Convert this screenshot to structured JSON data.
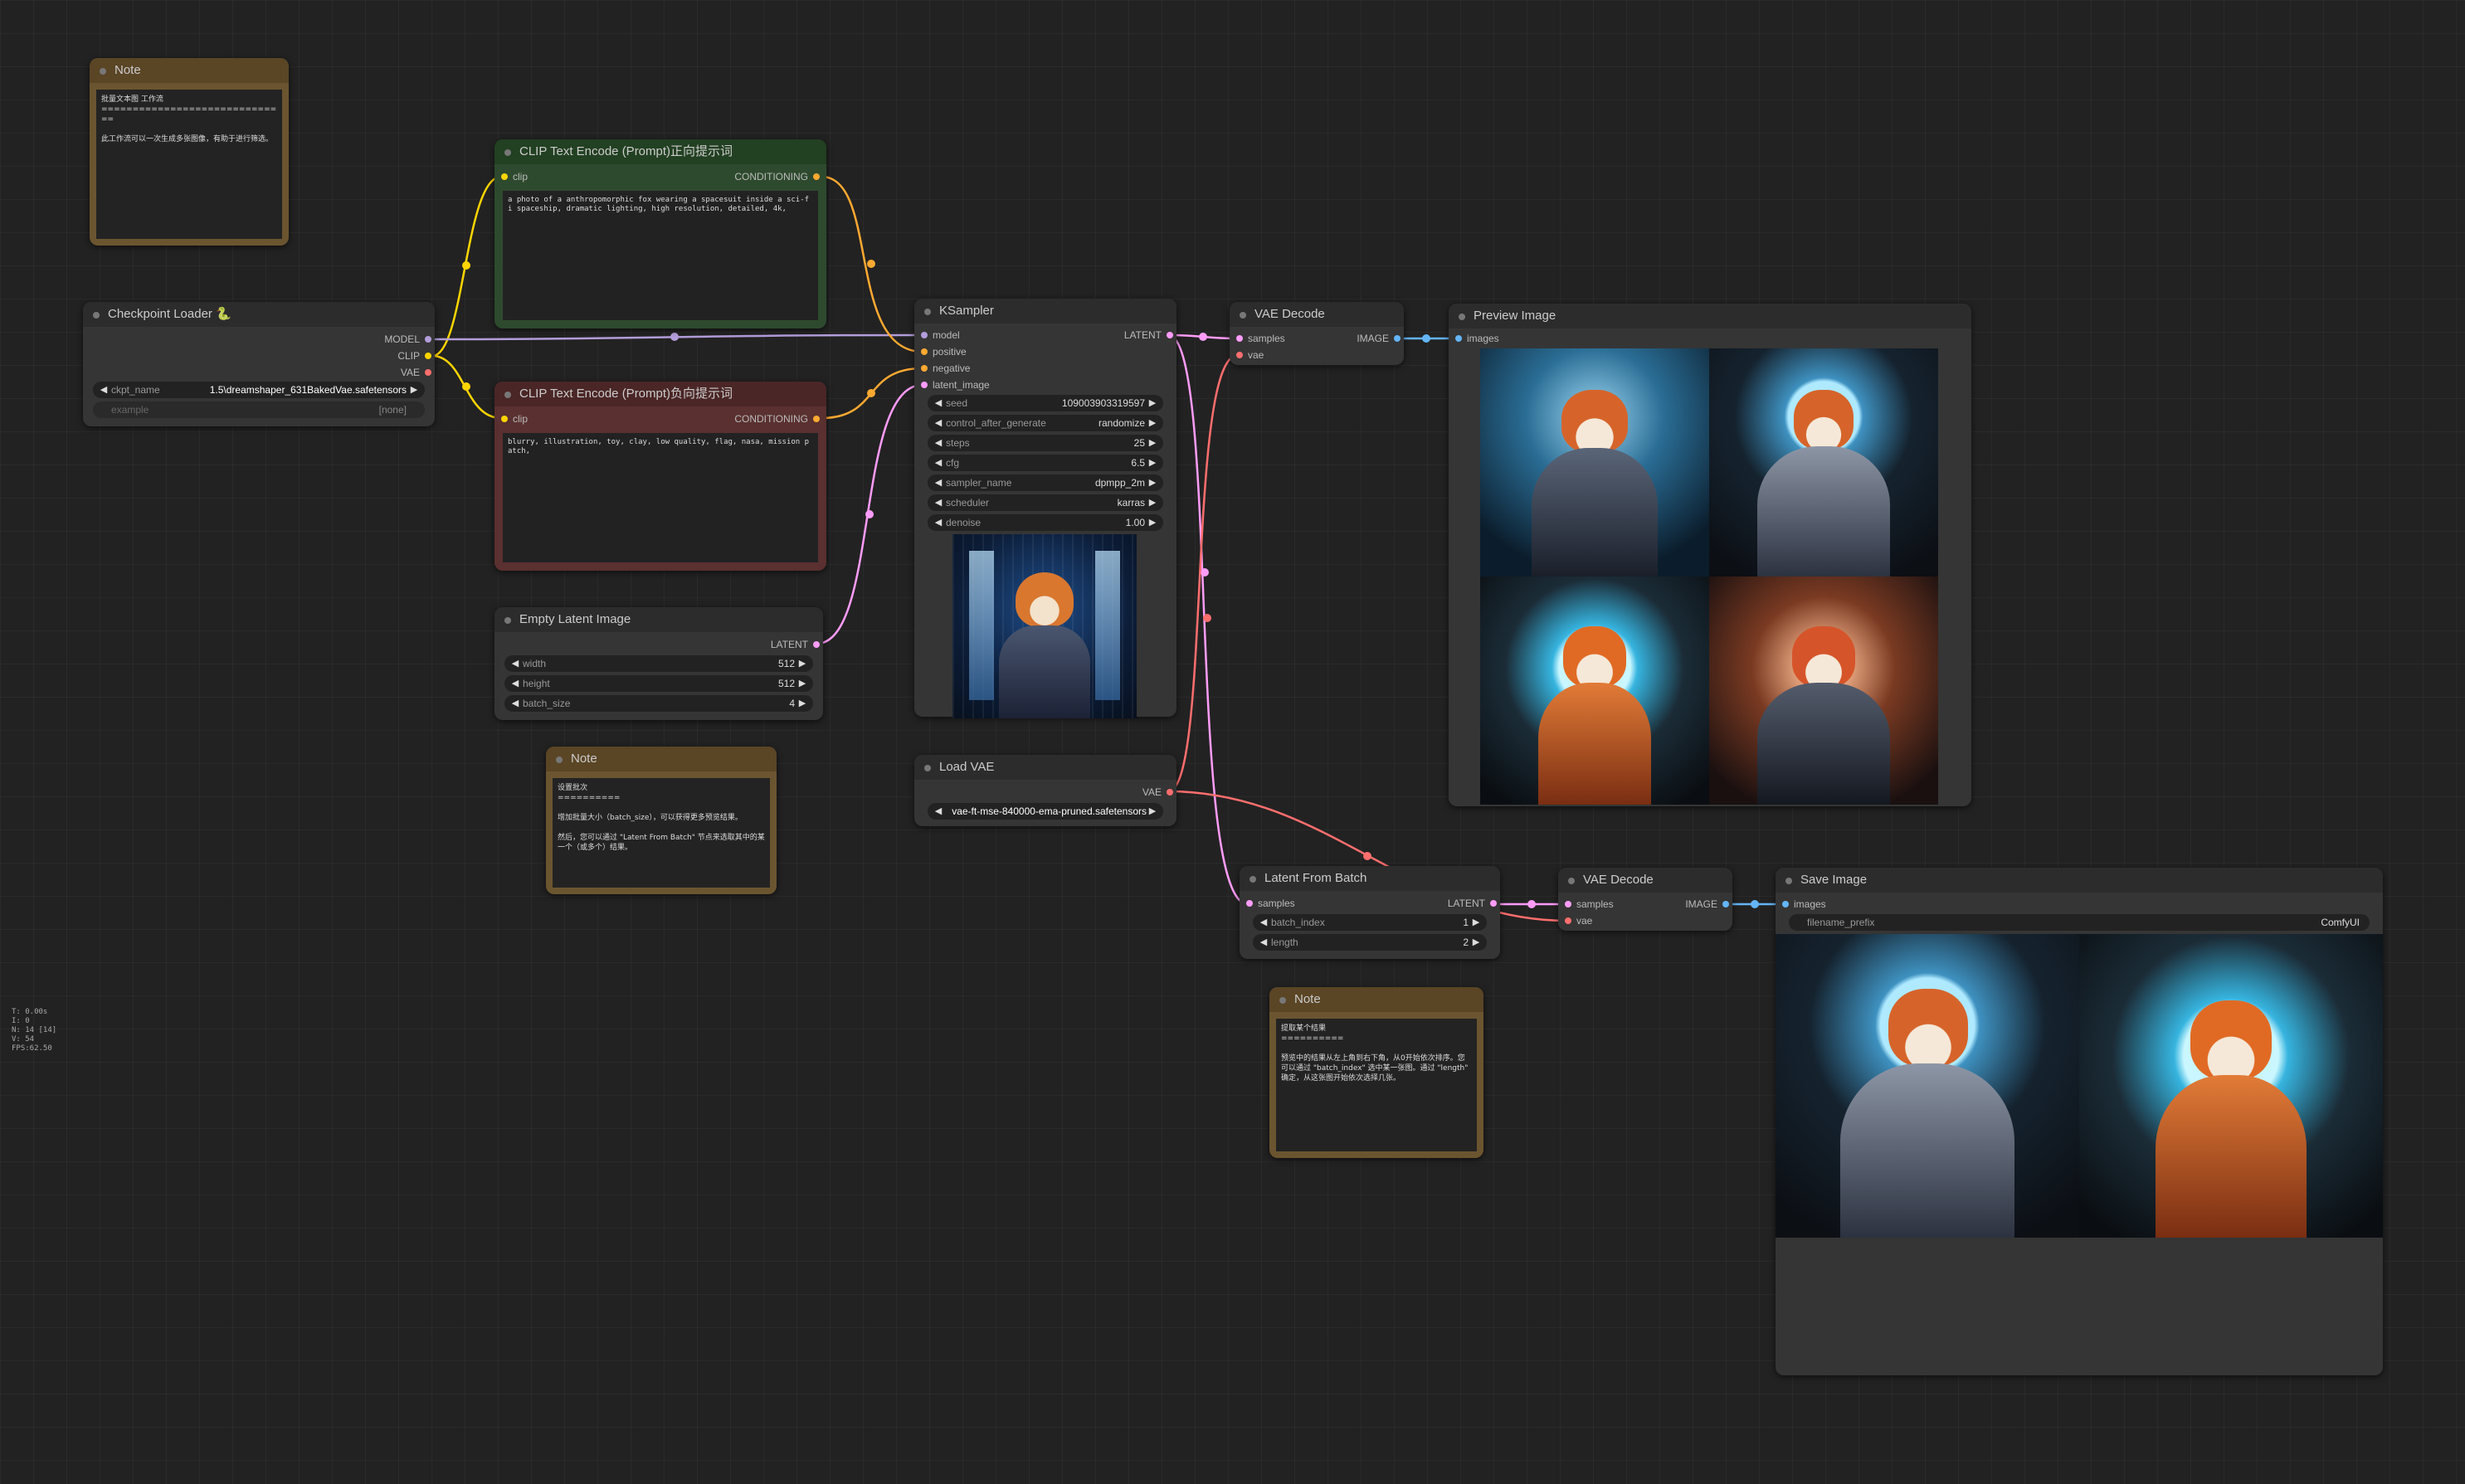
{
  "stats": [
    "T: 0.00s",
    "I: 0",
    "N: 14 [14]",
    "V: 54",
    "FPS:62.50"
  ],
  "colors": {
    "model": "#b39ddb",
    "clip": "#ffd500",
    "vae": "#ff6e6e",
    "conditioning": "#ffa931",
    "latent": "#ff9cf9",
    "image": "#64b5f6"
  },
  "nodes": {
    "note1": {
      "title": "Note",
      "text": "批量文本图 工作流\n==============================\n\n此工作流可以一次生成多张图像，有助于进行筛选。"
    },
    "clip_pos": {
      "title": "CLIP Text Encode (Prompt)正向提示词",
      "in": "clip",
      "out": "CONDITIONING",
      "text": "a photo of a anthropomorphic fox wearing a spacesuit inside a sci-fi spaceship, dramatic lighting, high resolution, detailed, 4k,"
    },
    "checkpoint": {
      "title": "Checkpoint Loader 🐍",
      "out_model": "MODEL",
      "out_clip": "CLIP",
      "out_vae": "VAE",
      "ckpt_label": "ckpt_name",
      "ckpt_value": "1.5\\dreamshaper_631BakedVae.safetensors",
      "example_label": "example",
      "example_value": "[none]"
    },
    "clip_neg": {
      "title": "CLIP Text Encode (Prompt)负向提示词",
      "in": "clip",
      "out": "CONDITIONING",
      "text": "blurry, illustration, toy, clay, low quality, flag, nasa, mission patch,"
    },
    "empty_latent": {
      "title": "Empty Latent Image",
      "out": "LATENT",
      "widgets": [
        {
          "label": "width",
          "value": "512"
        },
        {
          "label": "height",
          "value": "512"
        },
        {
          "label": "batch_size",
          "value": "4"
        }
      ]
    },
    "note2": {
      "title": "Note",
      "text": "设置批次\n==========\n\n增加批量大小（batch_size），可以获得更多预览结果。\n\n然后，您可以通过 \"Latent From Batch\" 节点来选取其中的某一个（或多个）结果。"
    },
    "ksampler": {
      "title": "KSampler",
      "inputs": [
        "model",
        "positive",
        "negative",
        "latent_image"
      ],
      "out": "LATENT",
      "widgets": [
        {
          "label": "seed",
          "value": "1090039033195​97"
        },
        {
          "label": "control_after_generate",
          "value": "randomize"
        },
        {
          "label": "steps",
          "value": "25"
        },
        {
          "label": "cfg",
          "value": "6.5"
        },
        {
          "label": "sampler_name",
          "value": "dpmpp_2m"
        },
        {
          "label": "scheduler",
          "value": "karras"
        },
        {
          "label": "denoise",
          "value": "1.00"
        }
      ]
    },
    "load_vae": {
      "title": "Load VAE",
      "out": "VAE",
      "widget_label": "vae_name",
      "widget_value": "vae-ft-mse-840000-ema-pruned.safetensors"
    },
    "vae_decode1": {
      "title": "VAE Decode",
      "in1": "samples",
      "in2": "vae",
      "out": "IMAGE"
    },
    "preview": {
      "title": "Preview Image",
      "in": "images"
    },
    "latent_from_batch": {
      "title": "Latent From Batch",
      "in": "samples",
      "out": "LATENT",
      "widgets": [
        {
          "label": "batch_index",
          "value": "1"
        },
        {
          "label": "length",
          "value": "2"
        }
      ]
    },
    "vae_decode2": {
      "title": "VAE Decode",
      "in1": "samples",
      "in2": "vae",
      "out": "IMAGE"
    },
    "save": {
      "title": "Save Image",
      "in": "images",
      "widget_label": "filename_prefix",
      "widget_value": "ComfyUI"
    },
    "note3": {
      "title": "Note",
      "text": "提取某个结果\n==========\n\n预览中的结果从左上角到右下角，从0开始依次排序。您可以通过 \"batch_index\" 选中某一张图。通过 \"length\" 确定，从这张图开始依次选择几张。"
    }
  }
}
